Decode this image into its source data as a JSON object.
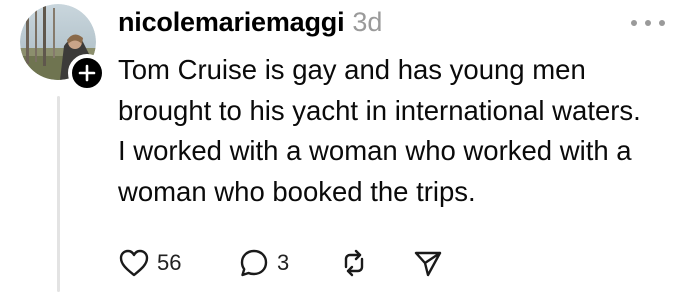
{
  "post": {
    "username": "nicolemariemaggi",
    "timestamp": "3d",
    "text_lines": [
      "Tom Cruise is gay and has young men",
      "brought to his yacht in international waters.",
      "I worked with a woman who worked with a",
      "woman who booked the trips."
    ]
  },
  "actions": {
    "like_count": "56",
    "reply_count": "3"
  },
  "icons": {
    "avatar": "profile-photo",
    "follow": "plus-icon",
    "more": "ellipsis-icon",
    "like": "heart-icon",
    "reply": "comment-icon",
    "repost": "repost-icon",
    "share": "send-icon"
  },
  "colors": {
    "text": "#0a0a0a",
    "muted": "#9a9a9a",
    "thread_line": "#e3e3e3",
    "badge": "#000000"
  }
}
